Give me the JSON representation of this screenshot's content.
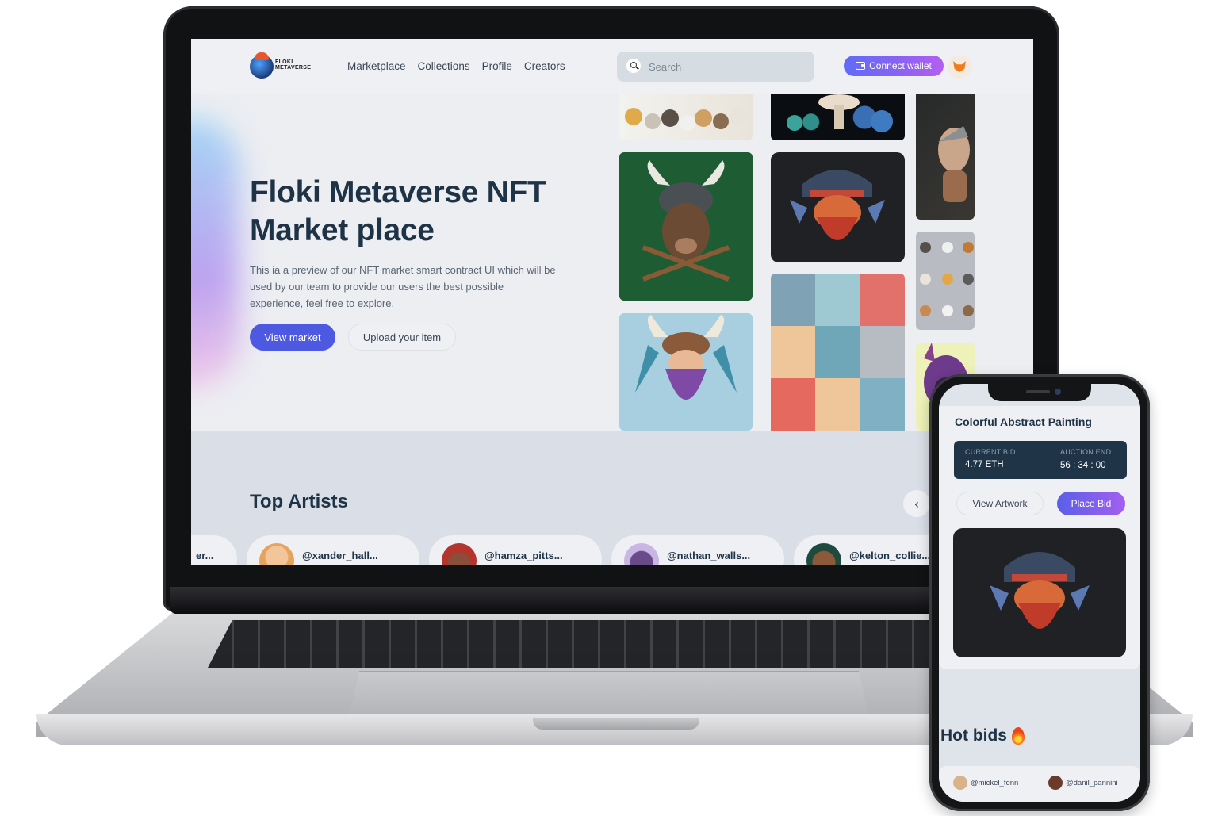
{
  "nav": {
    "logo_line1": "FLOKI",
    "logo_line2": "METAVERSE",
    "links": [
      "Marketplace",
      "Collections",
      "Profile",
      "Creators"
    ],
    "search_placeholder": "Search",
    "connect_label": "Connect wallet"
  },
  "hero": {
    "title": "Floki Metaverse NFT Market place",
    "description": "This ia a preview of our NFT market smart contract UI which will be used by our team to provide our users the best possible experience, feel free to explore.",
    "primary_button": "View market",
    "secondary_button": "Upload your item"
  },
  "top_artists": {
    "title": "Top Artists",
    "prev_icon": "‹",
    "artists": [
      "er...",
      "@xander_hall...",
      "@hamza_pitts...",
      "@nathan_walls...",
      "@kelton_collie..."
    ]
  },
  "phone": {
    "card_title": "Colorful Abstract Painting",
    "current_bid_label": "CURRENT BID",
    "current_bid_value": "4.77 ETH",
    "auction_end_label": "AUCTION END",
    "auction_end_value": "56 : 34 : 00",
    "view_artwork": "View Artwork",
    "place_bid": "Place Bid",
    "hot_bids_title": "Hot bids",
    "hot_bid_users": [
      "@mickel_fenn",
      "@danil_pannini"
    ]
  },
  "colors": {
    "primary": "#4c59e0",
    "heading": "#1f3347",
    "connect_gradient_start": "#5f6cf6",
    "connect_gradient_end": "#b45ff0",
    "bid_panel": "#203448"
  }
}
